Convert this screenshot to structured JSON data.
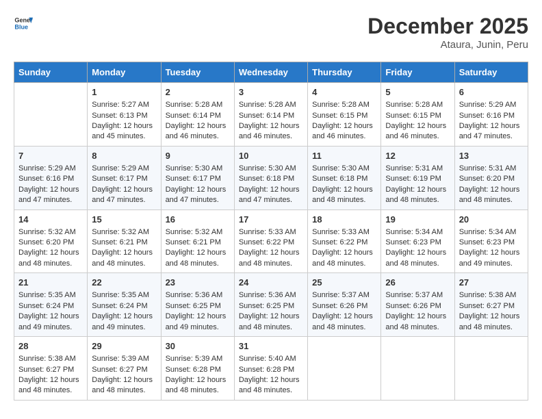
{
  "header": {
    "logo_line1": "General",
    "logo_line2": "Blue",
    "month": "December 2025",
    "location": "Ataura, Junin, Peru"
  },
  "days_of_week": [
    "Sunday",
    "Monday",
    "Tuesday",
    "Wednesday",
    "Thursday",
    "Friday",
    "Saturday"
  ],
  "weeks": [
    [
      {
        "day": "",
        "sunrise": "",
        "sunset": "",
        "daylight": ""
      },
      {
        "day": "1",
        "sunrise": "5:27 AM",
        "sunset": "6:13 PM",
        "daylight": "12 hours and 45 minutes."
      },
      {
        "day": "2",
        "sunrise": "5:28 AM",
        "sunset": "6:14 PM",
        "daylight": "12 hours and 46 minutes."
      },
      {
        "day": "3",
        "sunrise": "5:28 AM",
        "sunset": "6:14 PM",
        "daylight": "12 hours and 46 minutes."
      },
      {
        "day": "4",
        "sunrise": "5:28 AM",
        "sunset": "6:15 PM",
        "daylight": "12 hours and 46 minutes."
      },
      {
        "day": "5",
        "sunrise": "5:28 AM",
        "sunset": "6:15 PM",
        "daylight": "12 hours and 46 minutes."
      },
      {
        "day": "6",
        "sunrise": "5:29 AM",
        "sunset": "6:16 PM",
        "daylight": "12 hours and 47 minutes."
      }
    ],
    [
      {
        "day": "7",
        "sunrise": "5:29 AM",
        "sunset": "6:16 PM",
        "daylight": "12 hours and 47 minutes."
      },
      {
        "day": "8",
        "sunrise": "5:29 AM",
        "sunset": "6:17 PM",
        "daylight": "12 hours and 47 minutes."
      },
      {
        "day": "9",
        "sunrise": "5:30 AM",
        "sunset": "6:17 PM",
        "daylight": "12 hours and 47 minutes."
      },
      {
        "day": "10",
        "sunrise": "5:30 AM",
        "sunset": "6:18 PM",
        "daylight": "12 hours and 47 minutes."
      },
      {
        "day": "11",
        "sunrise": "5:30 AM",
        "sunset": "6:18 PM",
        "daylight": "12 hours and 48 minutes."
      },
      {
        "day": "12",
        "sunrise": "5:31 AM",
        "sunset": "6:19 PM",
        "daylight": "12 hours and 48 minutes."
      },
      {
        "day": "13",
        "sunrise": "5:31 AM",
        "sunset": "6:20 PM",
        "daylight": "12 hours and 48 minutes."
      }
    ],
    [
      {
        "day": "14",
        "sunrise": "5:32 AM",
        "sunset": "6:20 PM",
        "daylight": "12 hours and 48 minutes."
      },
      {
        "day": "15",
        "sunrise": "5:32 AM",
        "sunset": "6:21 PM",
        "daylight": "12 hours and 48 minutes."
      },
      {
        "day": "16",
        "sunrise": "5:32 AM",
        "sunset": "6:21 PM",
        "daylight": "12 hours and 48 minutes."
      },
      {
        "day": "17",
        "sunrise": "5:33 AM",
        "sunset": "6:22 PM",
        "daylight": "12 hours and 48 minutes."
      },
      {
        "day": "18",
        "sunrise": "5:33 AM",
        "sunset": "6:22 PM",
        "daylight": "12 hours and 48 minutes."
      },
      {
        "day": "19",
        "sunrise": "5:34 AM",
        "sunset": "6:23 PM",
        "daylight": "12 hours and 48 minutes."
      },
      {
        "day": "20",
        "sunrise": "5:34 AM",
        "sunset": "6:23 PM",
        "daylight": "12 hours and 49 minutes."
      }
    ],
    [
      {
        "day": "21",
        "sunrise": "5:35 AM",
        "sunset": "6:24 PM",
        "daylight": "12 hours and 49 minutes."
      },
      {
        "day": "22",
        "sunrise": "5:35 AM",
        "sunset": "6:24 PM",
        "daylight": "12 hours and 49 minutes."
      },
      {
        "day": "23",
        "sunrise": "5:36 AM",
        "sunset": "6:25 PM",
        "daylight": "12 hours and 49 minutes."
      },
      {
        "day": "24",
        "sunrise": "5:36 AM",
        "sunset": "6:25 PM",
        "daylight": "12 hours and 48 minutes."
      },
      {
        "day": "25",
        "sunrise": "5:37 AM",
        "sunset": "6:26 PM",
        "daylight": "12 hours and 48 minutes."
      },
      {
        "day": "26",
        "sunrise": "5:37 AM",
        "sunset": "6:26 PM",
        "daylight": "12 hours and 48 minutes."
      },
      {
        "day": "27",
        "sunrise": "5:38 AM",
        "sunset": "6:27 PM",
        "daylight": "12 hours and 48 minutes."
      }
    ],
    [
      {
        "day": "28",
        "sunrise": "5:38 AM",
        "sunset": "6:27 PM",
        "daylight": "12 hours and 48 minutes."
      },
      {
        "day": "29",
        "sunrise": "5:39 AM",
        "sunset": "6:27 PM",
        "daylight": "12 hours and 48 minutes."
      },
      {
        "day": "30",
        "sunrise": "5:39 AM",
        "sunset": "6:28 PM",
        "daylight": "12 hours and 48 minutes."
      },
      {
        "day": "31",
        "sunrise": "5:40 AM",
        "sunset": "6:28 PM",
        "daylight": "12 hours and 48 minutes."
      },
      {
        "day": "",
        "sunrise": "",
        "sunset": "",
        "daylight": ""
      },
      {
        "day": "",
        "sunrise": "",
        "sunset": "",
        "daylight": ""
      },
      {
        "day": "",
        "sunrise": "",
        "sunset": "",
        "daylight": ""
      }
    ]
  ]
}
